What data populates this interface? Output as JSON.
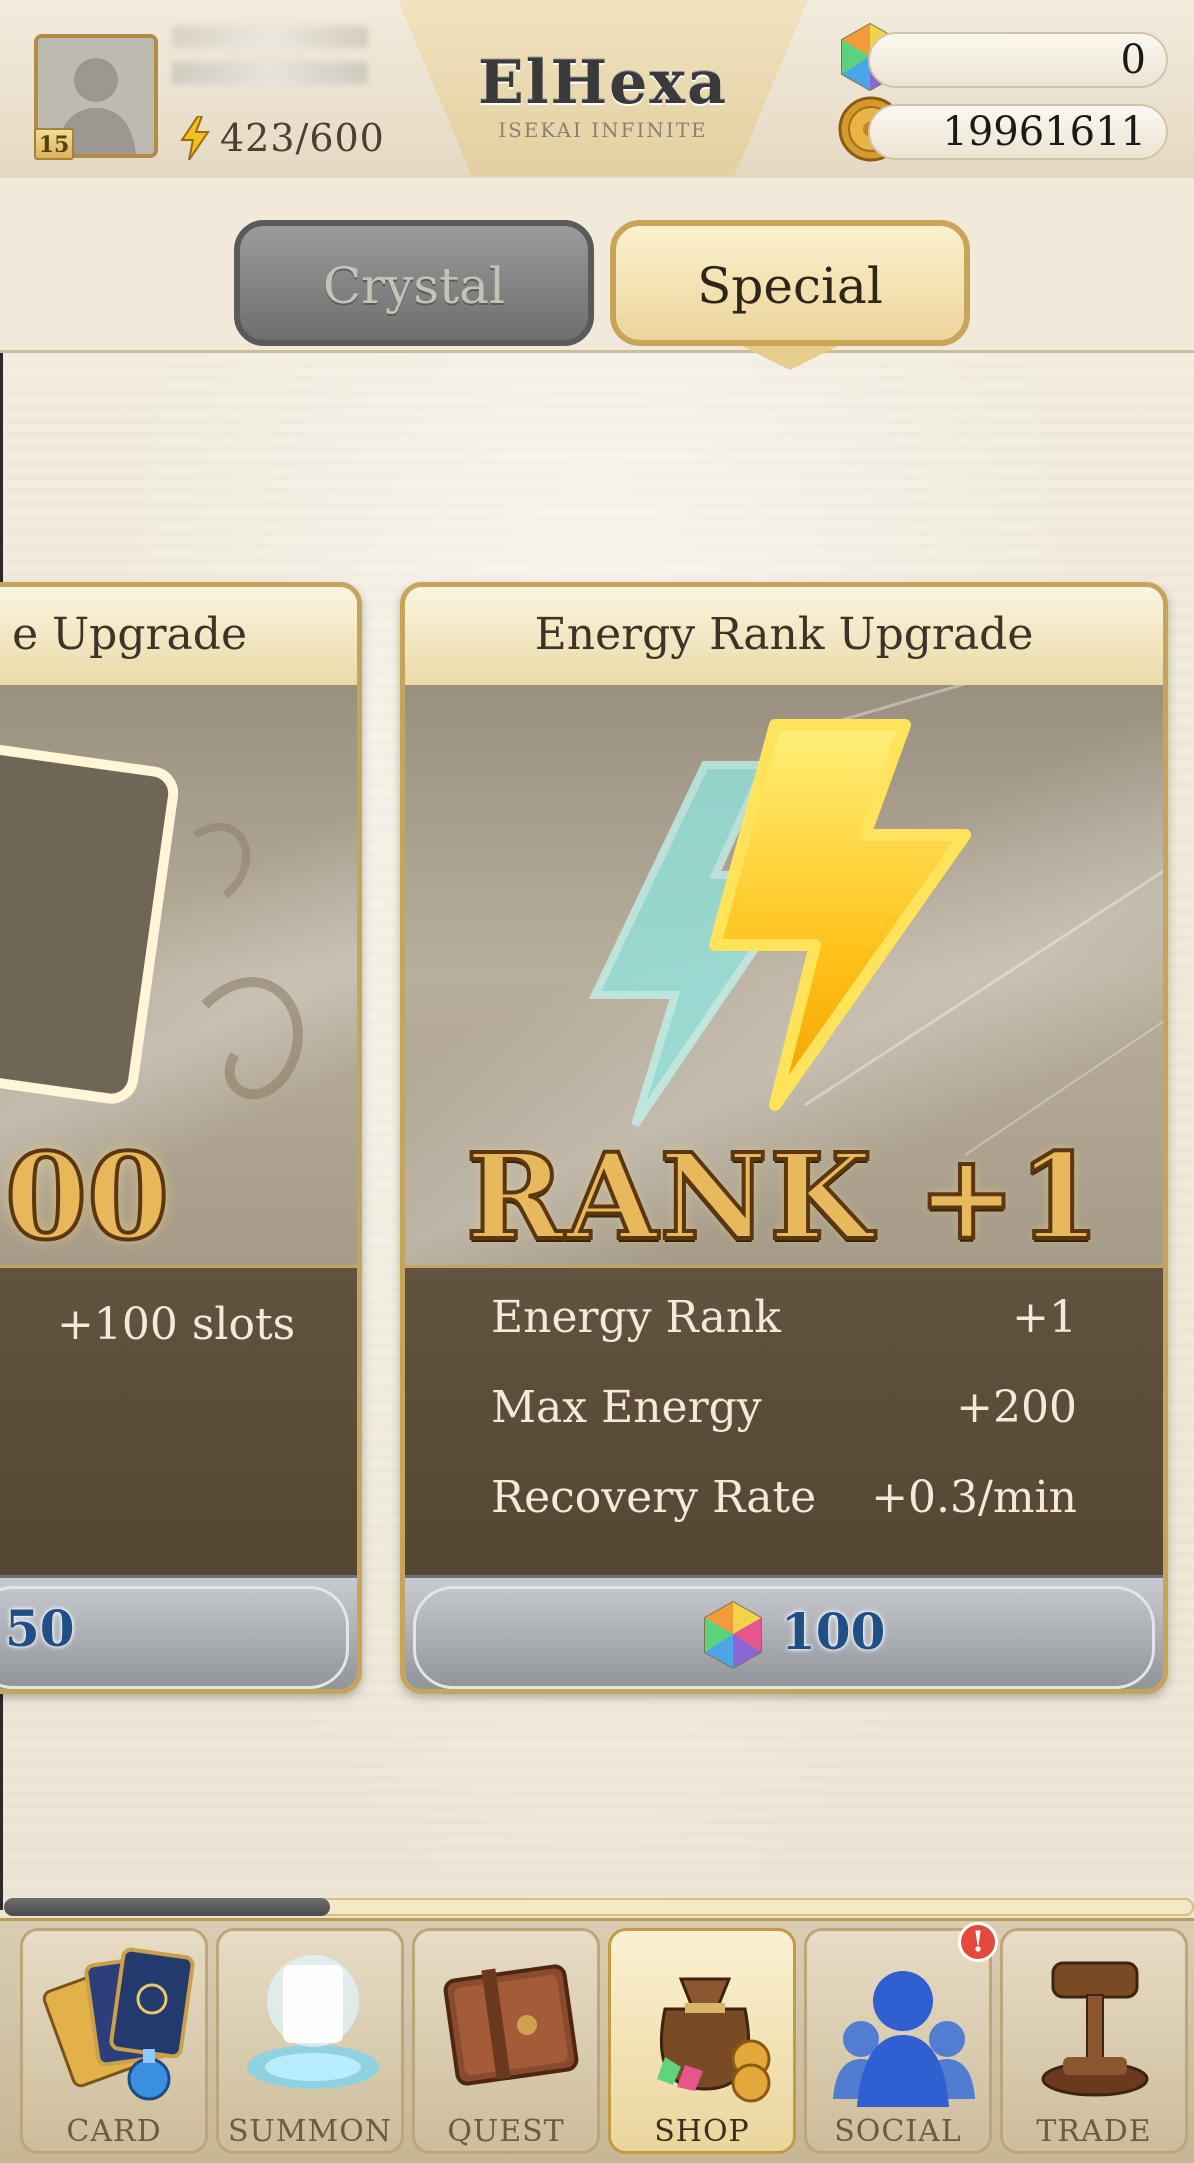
{
  "header": {
    "level": "15",
    "energy": "423/600",
    "logo_title": "ElHexa",
    "logo_subtitle": "ISEKAI INFINITE",
    "gem_count": "0",
    "gold_count": "19961611"
  },
  "tabs": [
    {
      "label": "Crystal",
      "active": false
    },
    {
      "label": "Special",
      "active": true
    }
  ],
  "cards": {
    "left": {
      "title_fragment": "e Upgrade",
      "big_text_fragment": "00",
      "detail": "+100 slots",
      "price_fragment": "50"
    },
    "main": {
      "title": "Energy Rank Upgrade",
      "art_text": "RANK +1",
      "rows": [
        {
          "label": "Energy Rank",
          "value": "+1"
        },
        {
          "label": "Max Energy",
          "value": "+200"
        },
        {
          "label": "Recovery Rate",
          "value": "+0.3/min"
        }
      ],
      "price": "100",
      "price_icon": "gem-icon"
    }
  },
  "scroll": {
    "position_fraction": 0.0
  },
  "nav": [
    {
      "label": "CARD",
      "icon": "card-icon",
      "active": false
    },
    {
      "label": "SUMMON",
      "icon": "summon-icon",
      "active": false
    },
    {
      "label": "QUEST",
      "icon": "quest-icon",
      "active": false
    },
    {
      "label": "SHOP",
      "icon": "shop-icon",
      "active": true
    },
    {
      "label": "SOCIAL",
      "icon": "social-icon",
      "active": false,
      "alert": "!"
    },
    {
      "label": "TRADE",
      "icon": "trade-icon",
      "active": false
    }
  ],
  "colors": {
    "accent_gold": "#c7a45c",
    "price_blue": "#1f4f86",
    "alert_red": "#e34a3b"
  }
}
